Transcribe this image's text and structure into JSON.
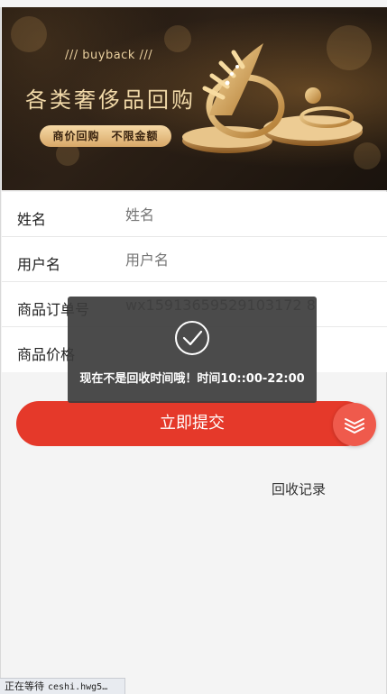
{
  "banner": {
    "subtitle": "/// buyback ///",
    "title": "各类奢侈品回购",
    "tag": "商价回购　不限金额"
  },
  "form": {
    "fields": [
      {
        "label": "姓名",
        "placeholder": "姓名",
        "value": ""
      },
      {
        "label": "用户名",
        "placeholder": "用户名",
        "value": ""
      },
      {
        "label": "商品订单号",
        "placeholder": "",
        "value": "wx15913659529103172 8"
      },
      {
        "label": "商品价格",
        "placeholder": "",
        "value": ""
      }
    ],
    "submit_label": "立即提交",
    "records_link": "回收记录"
  },
  "toast": {
    "message": "现在不是回收时间哦！时间10::00-22:00",
    "icon": "check-circle-icon"
  },
  "fab": {
    "icon": "layers-icon"
  },
  "statusbar": {
    "text": "正在等待",
    "url": "ceshi.hwg5…"
  },
  "colors": {
    "accent": "#e5392a",
    "fab": "#ef5a4c",
    "toast_bg": "#3c3c3c",
    "gold": "#f1d9a8"
  }
}
